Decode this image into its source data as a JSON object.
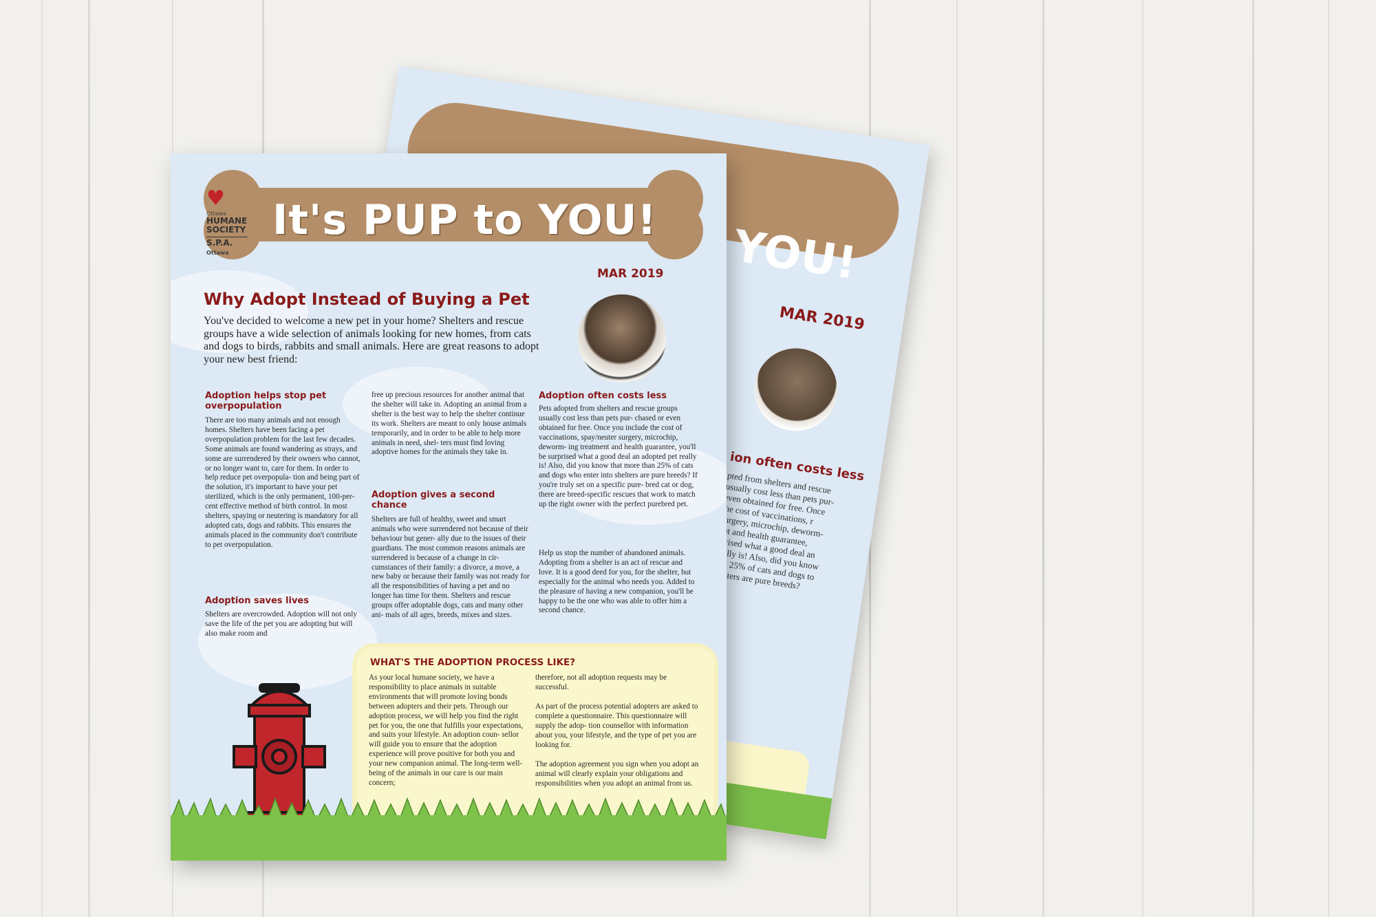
{
  "colors": {
    "accent_red": "#8a1a1a",
    "bone_brown": "#b48e68",
    "sheet_blue": "#dde9f4",
    "box_yellow": "#fbf7cc",
    "grass_green": "#7ec24c",
    "hydrant_red": "#c0262c"
  },
  "back_flyer": {
    "title_fragment": "YOU!",
    "date": "MAR 2019",
    "heading_fragment": "ion often costs less",
    "text_fragment": "pted from shelters and rescue usually cost less than pets pur- even obtained for free. Once the cost of vaccinations, r surgery, microchip, deworm- ent and health guarantee, rprised what a good deal an really is! Also, did you know han 25% of cats and dogs to shelters are pure breeds?"
  },
  "logo": {
    "city": "Ottawa",
    "line1": "HUMANE",
    "line2": "SOCIETY",
    "line3": "S.P.A.",
    "line3_small": "Ottawa",
    "icon": "cat-heart-dog-icon"
  },
  "header": {
    "title": "It's PUP to YOU!",
    "date": "MAR 2019"
  },
  "article": {
    "headline": "Why Adopt Instead of Buying a Pet",
    "intro": "You've decided to welcome a new pet in your home? Shelters and rescue groups have a wide selection of animals looking for new homes, from cats and dogs to birds, rabbits and small animals. Here are great reasons to adopt your new best friend:",
    "photo_icon": "cat-photo",
    "sections": [
      {
        "heading": "Adoption helps stop pet overpopulation",
        "text": "There are too many animals and not enough homes. Shelters have been facing a pet overpopulation problem for the last few decades. Some animals are found wandering as strays, and some are surrendered by their owners who cannot, or no longer want to, care for them. In order to help reduce pet overpopula- tion and being part of the solution, it's important to have your pet sterilized, which is the only permanent, 100-per- cent effective method of birth control. In most shelters, spaying or neutering is mandatory for all adopted cats, dogs and rabbits. This ensures the animals placed in the community don't contribute to pet overpopulation."
      },
      {
        "heading": "Adoption saves lives",
        "text": "Shelters are overcrowded. Adoption will not only save the life of the pet you are adopting but will also make room and"
      },
      {
        "continuation": "free up precious resources for another animal that the shelter will take in. Adopting an animal from a shelter is the best way to help the shelter continue its work. Shelters are meant to only house animals temporarily, and in order to be able to help more animals in need, shel- ters must find loving adoptive homes for the animals they take in."
      },
      {
        "heading": "Adoption gives a second chance",
        "text": "Shelters are full of healthy, sweet and smart animals who were surrendered not because of their behaviour but gener- ally due to the issues of their guardians. The most common reasons animals are surrendered is because of a change in cir- cumstances of their family: a divorce, a move, a new baby or because their family was not ready for all the responsibilities of having a pet and no longer has time for them. Shelters and rescue groups offer adoptable dogs, cats and many other ani- mals of all ages, breeds, mixes and sizes."
      },
      {
        "heading": "Adoption often costs less",
        "text": "Pets adopted from shelters and rescue groups usually cost less than pets pur- chased or even obtained for free. Once you include the cost of vaccinations, spay/neuter surgery, microchip, deworm- ing treatment and health guarantee, you'll be surprised what a good deal an adopted pet really is! Also, did you know that more than 25% of cats and dogs who enter into shelters are pure breeds? If you're truly set on a specific pure- bred cat or dog, there are breed-specific rescues that work to match up the right owner with the perfect purebred pet.",
        "text2": "Help us stop the number of abandoned animals. Adopting from a shelter is an act of rescue and love. It is a good deed for you, for the shelter, but especially for the animal who needs you. Added to the pleasure of having a new companion, you'll be happy to be the one who was able to offer him a second chance."
      }
    ]
  },
  "process_box": {
    "heading": "WHAT'S THE ADOPTION PROCESS LIKE?",
    "col1": "As your local humane society, we have a responsibility to place animals in suitable environments that will promote loving bonds between adopters and their pets. Through our adoption process, we will help you find the right pet for you, the one that fulfills your expectations, and suits your lifestyle. An adoption coun- sellor will guide you to ensure that the adoption experience will prove positive for both you and your new companion animal. The long-term well-being of the animals in our care is our main concern;",
    "col2_p1": "therefore, not all adoption requests may be successful.",
    "col2_p2": "As part of the process potential adopters are asked to complete a questionnaire. This questionnaire will supply the adop- tion counsellor with information about you, your lifestyle, and the type of pet you are looking for.",
    "col2_p3": "The adoption agreement you sign when you adopt an animal will clearly explain your obligations and responsibilities when you adopt an animal from us."
  },
  "illustrations": {
    "hydrant": "fire-hydrant-icon",
    "grass": "grass-strip"
  }
}
